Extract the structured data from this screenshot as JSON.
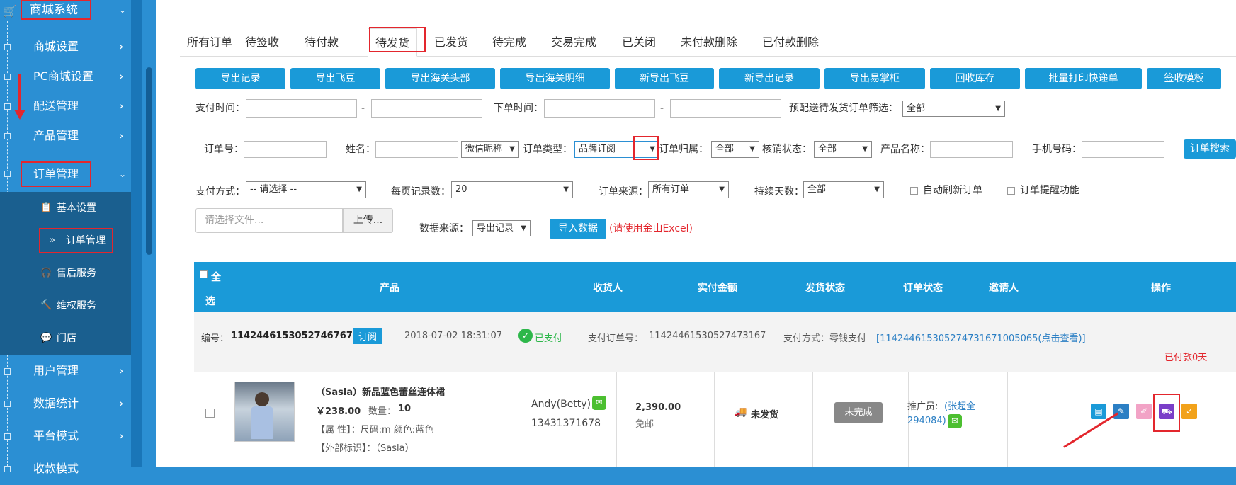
{
  "sidebar": {
    "top": "商城系统",
    "items": [
      {
        "label": "商城设置"
      },
      {
        "label": "PC商城设置"
      },
      {
        "label": "配送管理"
      },
      {
        "label": "产品管理"
      },
      {
        "label": "订单管理"
      },
      {
        "label": "用户管理"
      },
      {
        "label": "数据统计"
      },
      {
        "label": "平台模式"
      },
      {
        "label": "收款模式"
      }
    ],
    "sub": [
      {
        "label": "基本设置"
      },
      {
        "label": "订单管理"
      },
      {
        "label": "售后服务"
      },
      {
        "label": "维权服务"
      },
      {
        "label": "门店"
      }
    ]
  },
  "tabs": [
    "所有订单",
    "待签收",
    "待付款",
    "待发货",
    "已发货",
    "待完成",
    "交易完成",
    "已关闭",
    "未付款删除",
    "已付款删除"
  ],
  "buttons": [
    "导出记录",
    "导出飞豆",
    "导出海关头部",
    "导出海关明细",
    "新导出飞豆",
    "新导出记录",
    "导出易掌柜",
    "回收库存",
    "批量打印快递单",
    "签收模板"
  ],
  "filters": {
    "pay_time": "支付时间：",
    "dash": "-",
    "order_time": "下单时间：",
    "pre_filter": "预配送待发货订单筛选：",
    "pre_filter_val": "全部",
    "order_no": "订单号：",
    "name": "姓名：",
    "wx_nick": "微信昵称",
    "order_type": "订单类型：",
    "order_type_val": "品牌订阅",
    "order_owner": "订单归属：",
    "owner_val": "全部",
    "verify": "核销状态：",
    "verify_val": "全部",
    "product_name": "产品名称：",
    "phone": "手机号码：",
    "search_btn": "订单搜索",
    "pay_method": "支付方式：",
    "pay_method_val": "-- 请选择 --",
    "per_page": "每页记录数：",
    "per_page_val": "20",
    "source": "订单来源：",
    "source_val": "所有订单",
    "days": "持续天数：",
    "days_val": "全部",
    "auto_refresh": "自动刷新订单",
    "remind": "订单提醒功能",
    "file_placeholder": "请选择文件...",
    "upload": "上传...",
    "data_source": "数据来源：",
    "data_source_val": "导出记录",
    "import": "导入数据",
    "import_hint": "(请使用金山Excel)"
  },
  "table": {
    "headers": [
      "全",
      "选",
      "产品",
      "收货人",
      "实付金额",
      "发货状态",
      "订单状态",
      "邀请人",
      "操作"
    ]
  },
  "order": {
    "no_label": "编号：",
    "no": "1142446153052746767 20",
    "tag": "订阅",
    "time": "2018-07-02 18:31:07",
    "paid": "已支付",
    "pay_no_label": "支付订单号：",
    "pay_no": "11424461530527473167",
    "pay_method_label": "支付方式：零钱支付",
    "pay_link": "[114244615305274731671005065(点击查看)]",
    "paid_days": "已付款0天",
    "product_title": "（Sasla）新品蓝色蕾丝连体裙",
    "price": "￥238.00",
    "qty_label": "数量：",
    "qty": "10",
    "attr": "【属 性】：尺码:m 颜色:蓝色",
    "ext": "【外部标识】：（Sasla）",
    "receiver": "Andy(Betty)",
    "phone": "13431371678",
    "amount": "2,390.00",
    "ship_fee": "免邮",
    "ship_status": "未发货",
    "order_status": "未完成",
    "promoter_label": "推广员:",
    "promoter": "(张超全",
    "promoter2": "294084)"
  }
}
